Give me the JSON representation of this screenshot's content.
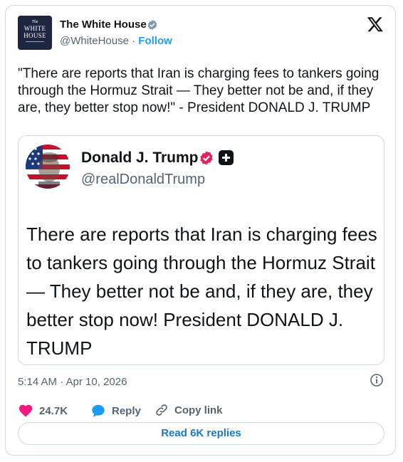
{
  "author": {
    "name": "The White House",
    "handle": "@WhiteHouse",
    "separator": "·",
    "follow_label": "Follow",
    "avatar": {
      "line1": "The",
      "line2": "WHITE",
      "line3": "HOUSE"
    }
  },
  "tweet": {
    "text": "\"There are reports that Iran is charging fees to tankers going through the Hormuz Strait — They better not be and, if they are, they better stop now!\" - President DONALD J. TRUMP",
    "timestamp": "5:14 AM · Apr 10, 2026"
  },
  "quoted_post": {
    "name": "Donald J. Trump",
    "handle": "@realDonaldTrump",
    "text": "There are reports that Iran is charging fees to tankers going through the Hormuz Strait — They better not be and, if they are, they better stop now! President DONALD J. TRUMP"
  },
  "actions": {
    "likes": "24.7K",
    "reply_label": "Reply",
    "copy_link_label": "Copy link"
  },
  "read_replies_label": "Read 6K replies",
  "colors": {
    "like": "#f91880",
    "reply": "#1d9bf0",
    "link": "#1d77c2",
    "verified_gray": "#829aab",
    "verified_pink": "#e0245e"
  },
  "icons": [
    "verified-badge-icon",
    "x-logo-icon",
    "heart-icon",
    "reply-bubble-icon",
    "link-icon",
    "info-icon",
    "plus-icon"
  ]
}
